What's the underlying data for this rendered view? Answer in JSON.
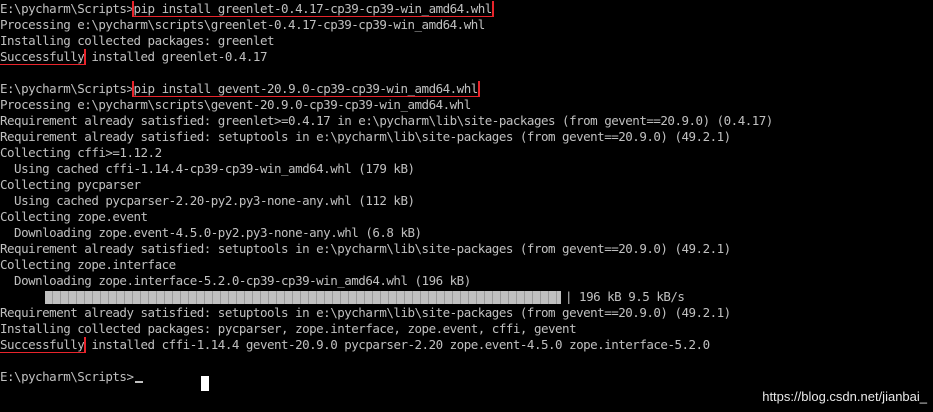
{
  "terminal": {
    "lines": [
      {
        "prompt": "E:\\pycharm\\Scripts>",
        "cmd": "pip install greenlet-0.4.17-cp39-cp39-win_amd64.whl"
      },
      {
        "text": "Processing e:\\pycharm\\scripts\\greenlet-0.4.17-cp39-cp39-win_amd64.whl"
      },
      {
        "text": "Installing collected packages: greenlet"
      },
      {
        "hl": "Successfully",
        "rest": " installed greenlet-0.4.17"
      },
      {
        "text": ""
      },
      {
        "prompt": "E:\\pycharm\\Scripts>",
        "cmd": "pip install gevent-20.9.0-cp39-cp39-win_amd64.whl"
      },
      {
        "text": "Processing e:\\pycharm\\scripts\\gevent-20.9.0-cp39-cp39-win_amd64.whl"
      },
      {
        "text": "Requirement already satisfied: greenlet>=0.4.17 in e:\\pycharm\\lib\\site-packages (from gevent==20.9.0) (0.4.17)"
      },
      {
        "text": "Requirement already satisfied: setuptools in e:\\pycharm\\lib\\site-packages (from gevent==20.9.0) (49.2.1)"
      },
      {
        "text": "Collecting cffi>=1.12.2"
      },
      {
        "text": "  Using cached cffi-1.14.4-cp39-cp39-win_amd64.whl (179 kB)"
      },
      {
        "text": "Collecting pycparser"
      },
      {
        "text": "  Using cached pycparser-2.20-py2.py3-none-any.whl (112 kB)"
      },
      {
        "text": "Collecting zope.event"
      },
      {
        "text": "  Downloading zope.event-4.5.0-py2.py3-none-any.whl (6.8 kB)"
      },
      {
        "text": "Requirement already satisfied: setuptools in e:\\pycharm\\lib\\site-packages (from gevent==20.9.0) (49.2.1)"
      },
      {
        "text": "Collecting zope.interface"
      },
      {
        "text": "  Downloading zope.interface-5.2.0-cp39-cp39-win_amd64.whl (196 kB)"
      },
      {
        "progress": true
      },
      {
        "text": "Requirement already satisfied: setuptools in e:\\pycharm\\lib\\site-packages (from gevent==20.9.0) (49.2.1)"
      },
      {
        "text": "Installing collected packages: pycparser, zope.interface, zope.event, cffi, gevent"
      },
      {
        "hl": "Successfully",
        "rest": " installed cffi-1.14.4 gevent-20.9.0 pycparser-2.20 zope.event-4.5.0 zope.interface-5.2.0"
      },
      {
        "text": ""
      },
      {
        "prompt": "E:\\pycharm\\Scripts>",
        "cursor": true
      }
    ],
    "progress": {
      "fraction": 1.0,
      "status": "| 196 kB 9.5 kB/s"
    }
  },
  "watermark": "https://blog.csdn.net/jianbai_",
  "colors": {
    "background": "#000000",
    "text": "#c0c0c0",
    "highlight_box": "#e8242b"
  }
}
